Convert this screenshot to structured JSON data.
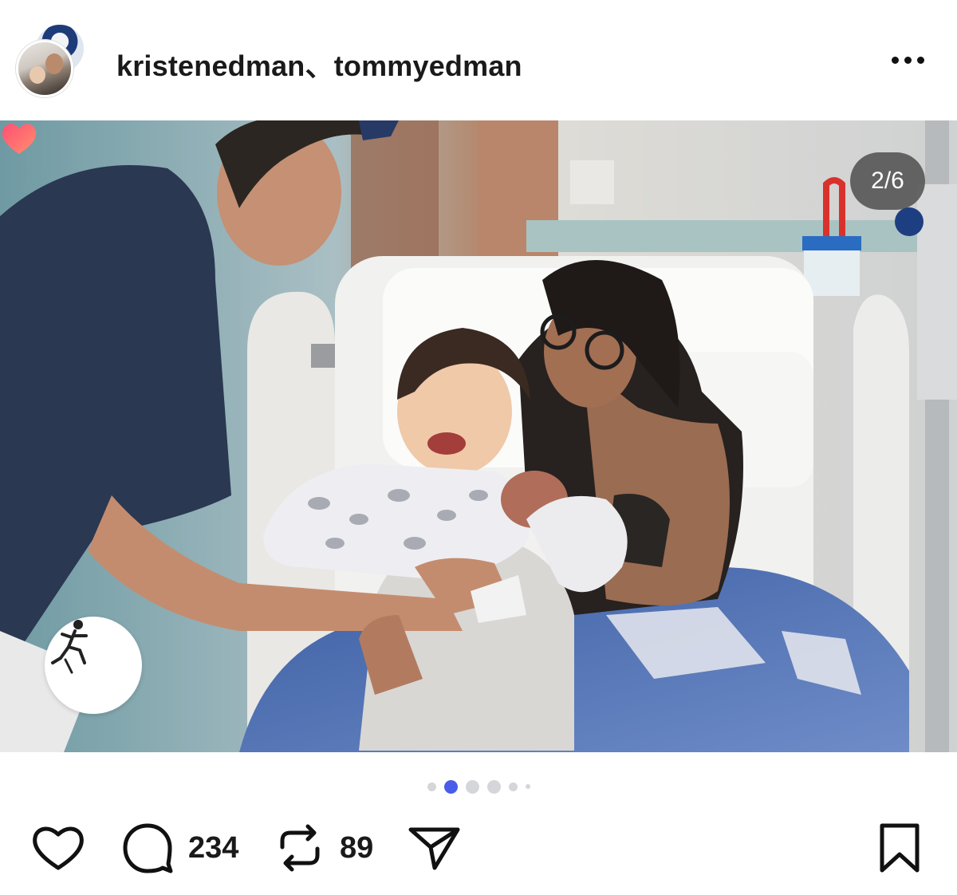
{
  "post": {
    "usernames": "kristenedman、tommyedman",
    "slide_counter": "2/6",
    "current_slide": 2,
    "total_slides": 6
  },
  "actions": {
    "comments_count": "234",
    "reposts_count": "89"
  },
  "icons": {
    "more": "more-icon",
    "like": "heart-icon",
    "comment": "comment-icon",
    "repost": "repost-icon",
    "share": "send-icon",
    "save": "bookmark-icon"
  },
  "colors": {
    "active_dot": "#4a5de8",
    "inactive_dot": "#d4d6da",
    "counter_bg": "#3c3c3c",
    "sticker_heart": "#ff5a7a"
  }
}
